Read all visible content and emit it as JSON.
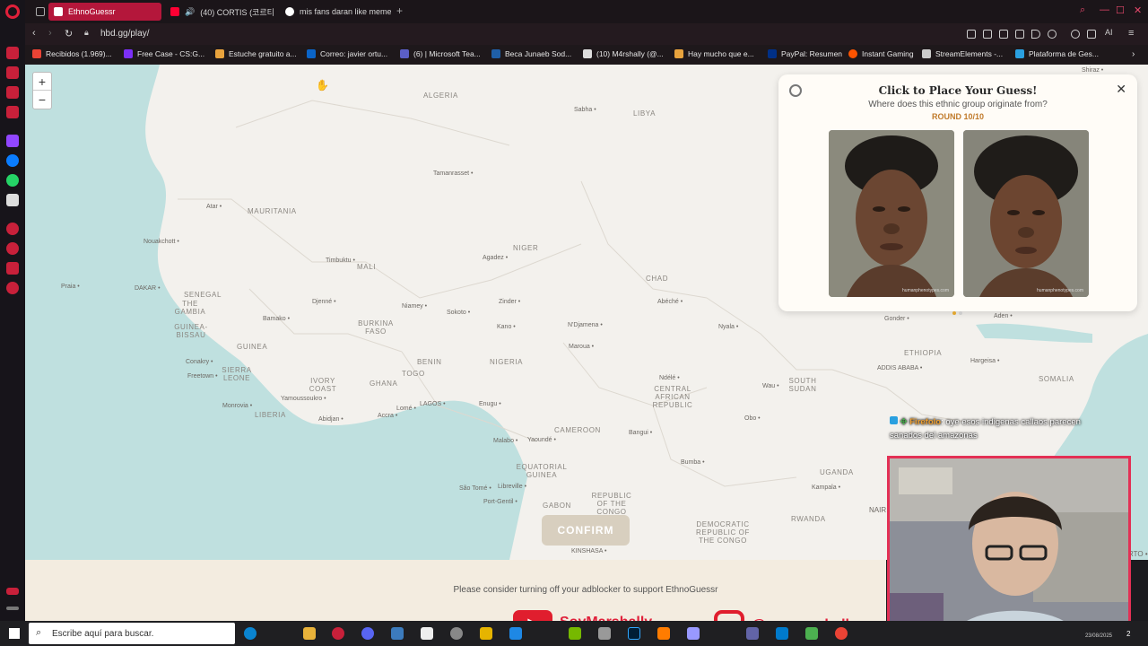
{
  "browser": {
    "tabs": [
      {
        "label": "EthnoGuessr",
        "active": true
      },
      {
        "label": "(40) CORTIS (코르티스",
        "active": false
      },
      {
        "label": "mis fans daran like meme",
        "active": false
      }
    ],
    "url": "hbd.gg/play/",
    "bookmarks": [
      "Recibidos (1.969)...",
      "Free Case - CS:G...",
      "Estuche gratuito a...",
      "Correo: javier ortu...",
      "(6) | Microsoft Tea...",
      "Beca Junaeb Sod...",
      "(10) M4rshally (@...",
      "Hay mucho que e...",
      "PayPal: Resumen",
      "Instant Gaming",
      "StreamElements -...",
      "Plataforma de Ges..."
    ],
    "ai_label": "AI"
  },
  "map": {
    "zoom_in": "+",
    "zoom_out": "−",
    "countries": [
      {
        "name": "ALGERIA",
        "id": "algeria"
      },
      {
        "name": "LIBYA",
        "id": "libya"
      },
      {
        "name": "MAURITANIA",
        "id": "mauritania"
      },
      {
        "name": "MALI",
        "id": "mali"
      },
      {
        "name": "NIGER",
        "id": "niger"
      },
      {
        "name": "CHAD",
        "id": "chad"
      },
      {
        "name": "SENEGAL",
        "id": "senegal"
      },
      {
        "name": "THE GAMBIA",
        "id": "gambia"
      },
      {
        "name": "GUINEA-BISSAU",
        "id": "guinea-bissau"
      },
      {
        "name": "GUINEA",
        "id": "guinea"
      },
      {
        "name": "SIERRA LEONE",
        "id": "sierra-leone"
      },
      {
        "name": "LIBERIA",
        "id": "liberia"
      },
      {
        "name": "IVORY COAST",
        "id": "ivory-coast"
      },
      {
        "name": "BURKINA FASO",
        "id": "burkina-faso"
      },
      {
        "name": "GHANA",
        "id": "ghana"
      },
      {
        "name": "TOGO",
        "id": "togo"
      },
      {
        "name": "BENIN",
        "id": "benin"
      },
      {
        "name": "NIGERIA",
        "id": "nigeria"
      },
      {
        "name": "CAMEROON",
        "id": "cameroon"
      },
      {
        "name": "CENTRAL AFRICAN REPUBLIC",
        "id": "car"
      },
      {
        "name": "SOUTH SUDAN",
        "id": "south-sudan"
      },
      {
        "name": "ETHIOPIA",
        "id": "ethiopia"
      },
      {
        "name": "SOMALIA",
        "id": "somalia"
      },
      {
        "name": "EQUATORIAL GUINEA",
        "id": "eq-guinea"
      },
      {
        "name": "GABON",
        "id": "gabon"
      },
      {
        "name": "REPUBLIC OF THE CONGO",
        "id": "roc"
      },
      {
        "name": "DEMOCRATIC REPUBLIC OF THE CONGO",
        "id": "drc"
      },
      {
        "name": "UGANDA",
        "id": "uganda"
      },
      {
        "name": "RWANDA",
        "id": "rwanda"
      }
    ],
    "cities": [
      "Sabha",
      "Tamanrasset",
      "Atar",
      "Nouakchott",
      "Praia",
      "DAKAR",
      "Timbuktu",
      "Agadez",
      "Djenné",
      "Niamey",
      "Sokoto",
      "Zinder",
      "Kano",
      "N'Djamena",
      "Maroua",
      "Abéché",
      "Nyala",
      "Bamako",
      "Conakry",
      "Freetown",
      "Yamoussoukro",
      "Monrovia",
      "Abidjan",
      "Accra",
      "Lomé",
      "LAGOS",
      "Enugu",
      "Ndélé",
      "Wau",
      "Obo",
      "Bangui",
      "Malabo",
      "Yaoundé",
      "Bumba",
      "São Tomé",
      "Libreville",
      "Port-Gentil",
      "KINSHASA",
      "Kampala",
      "Gonder",
      "ADDIS ABABA",
      "Hargeisa",
      "Aden",
      "Shiraz"
    ],
    "edge_labels": [
      "NAIR",
      "RTO"
    ],
    "confirm_label": "CONFIRM"
  },
  "panel": {
    "title": "Click to Place Your Guess!",
    "subtitle": "Where does this ethnic group originate from?",
    "round": "ROUND 10/10",
    "watermark": "humanphenotypes.com",
    "images": [
      {
        "alt": "face-1"
      },
      {
        "alt": "face-2"
      }
    ]
  },
  "ad_notice": "Please consider turning off your adblocker to support EthnoGuessr",
  "stream": {
    "chat_user": "Firefolo",
    "chat_message": ": oye esos indigenas callaos parecen sanados del amazonas",
    "youtube_handle": "SoyMarshally",
    "instagram_handle": "@soymarshally"
  },
  "taskbar": {
    "search_placeholder": "Escribe aquí para buscar.",
    "date_text": "23/08/2025",
    "notification_count": "2"
  },
  "colors": {
    "accent": "#b4173b",
    "map_bg": "#f3f1ed",
    "water": "#bfe0df",
    "confirm_bg": "#d8cfbf",
    "webcam_border": "#e33055"
  }
}
